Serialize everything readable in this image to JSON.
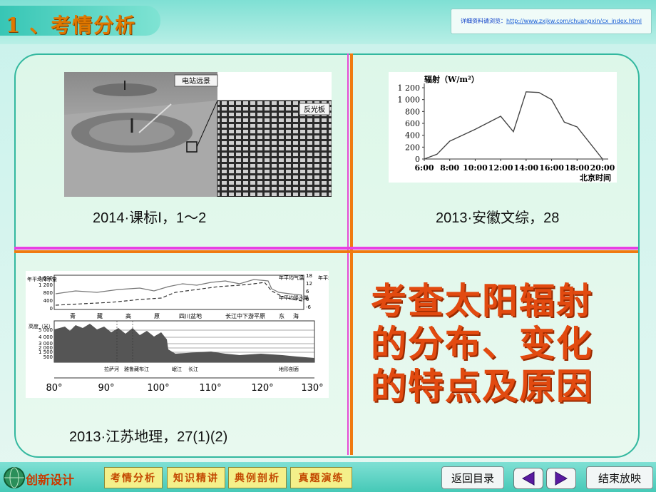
{
  "header": {
    "title": "1 、考情分析",
    "url_prefix": "详细资料请浏览：",
    "url": "http://www.zxjkw.com/chuangxin/cx_index.html"
  },
  "quadrants": {
    "top_left": {
      "caption": "2014·课标Ⅰ，1～2",
      "image_labels": [
        "电站远景",
        "反光板"
      ]
    },
    "top_right": {
      "caption": "2013·安徽文综，28"
    },
    "bottom_left": {
      "caption": "2013·江苏地理，27(1)(2)",
      "profile": {
        "legend": [
          "年平均气温",
          "年平均降水量"
        ],
        "left_axis_top": [
          "年平均降水量"
        ],
        "right_axis_top": [
          "年平均气温（℃）"
        ],
        "region_labels": [
          "青",
          "藏",
          "高",
          "原",
          "四川盆地",
          "长江中下游平原",
          "东",
          "海"
        ],
        "left_ticks_top": [
          "1 600",
          "1 200",
          "800",
          "400",
          "0"
        ],
        "right_ticks_top": [
          "18",
          "12",
          "6",
          "0",
          "-6"
        ],
        "height_label": "高度（米）",
        "height_ticks": [
          "5 000",
          "4 000",
          "3 000",
          "2 000",
          "1 500",
          "500"
        ],
        "place_labels": [
          "拉萨河",
          "雅鲁藏布江",
          "岷江",
          "长江",
          "地形剖面"
        ],
        "x_ticks": [
          "80°",
          "90°",
          "100°",
          "110°",
          "120°",
          "130°"
        ]
      }
    },
    "bottom_right": {
      "summary_lines": [
        "考查太阳辐射",
        "的分布、变化",
        "的特点及原因"
      ]
    }
  },
  "chart_data": {
    "type": "line",
    "title": "",
    "ylabel": "辐射（W/m²）",
    "xlabel": "北京时间",
    "x": [
      "6:00",
      "7:00",
      "8:00",
      "10:00",
      "12:00",
      "13:00",
      "14:00",
      "15:00",
      "16:00",
      "17:00",
      "18:00",
      "20:00"
    ],
    "values": [
      0,
      80,
      300,
      500,
      720,
      460,
      1130,
      1120,
      1000,
      620,
      540,
      0
    ],
    "x_tick_labels": [
      "6:00",
      "8:00",
      "10:00",
      "12:00",
      "14:00",
      "16:00",
      "18:00",
      "20:00"
    ],
    "y_tick_labels": [
      "1 200",
      "1 000",
      "800",
      "600",
      "400",
      "200",
      "0"
    ],
    "ylim": [
      0,
      1200
    ],
    "grid": false,
    "legend": "none"
  },
  "footer": {
    "logo_text": "创新设计",
    "nav_tabs": [
      "考情分析",
      "知识精讲",
      "典例剖析",
      "真题演练"
    ],
    "back_button": "返回目录",
    "end_button": "结束放映"
  }
}
